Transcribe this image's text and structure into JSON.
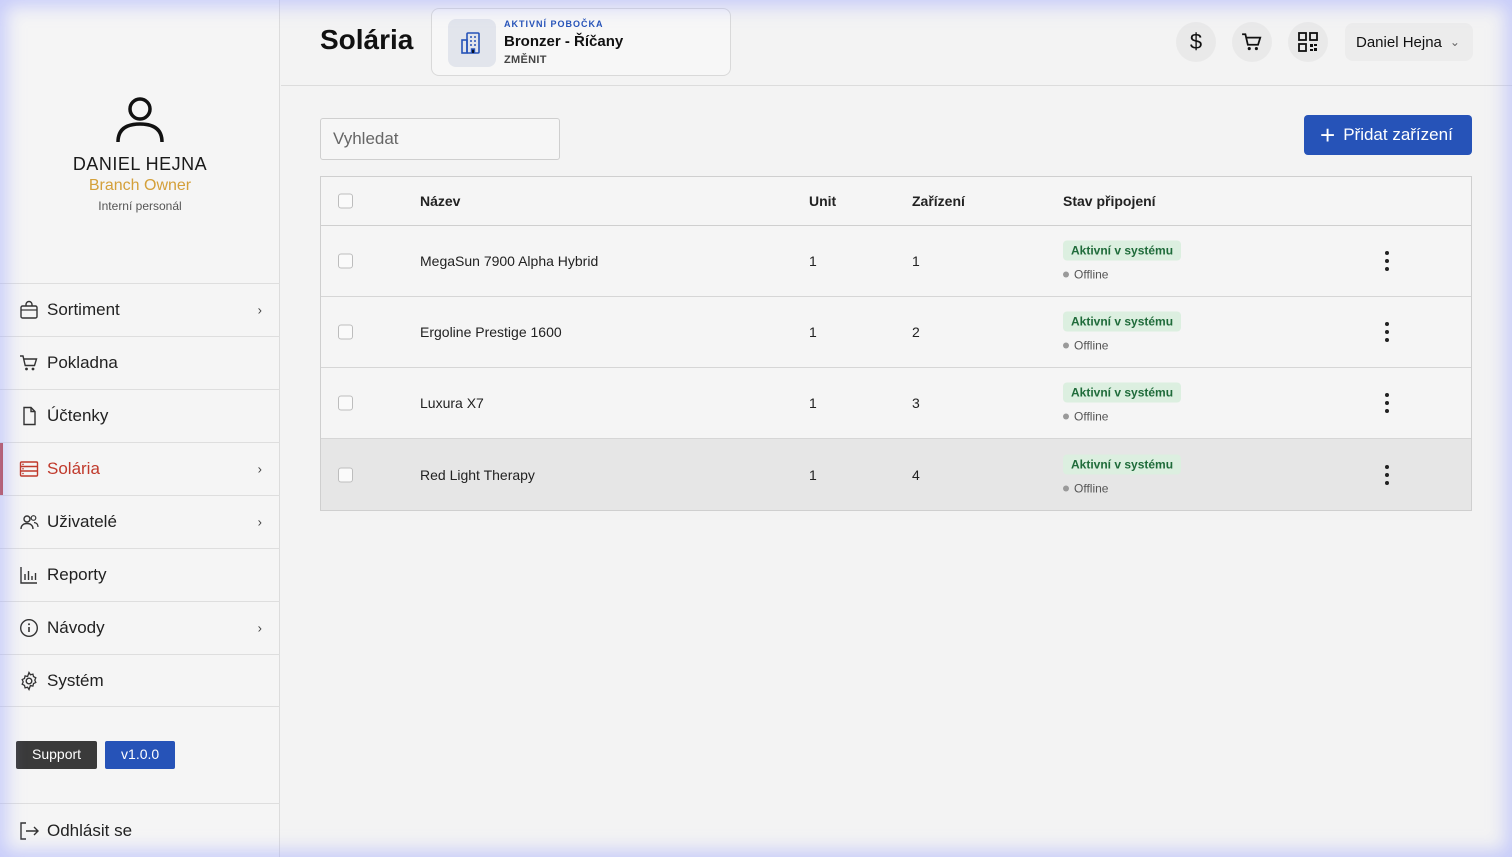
{
  "header": {
    "title": "Solária",
    "branch": {
      "kicker": "AKTIVNÍ POBOČKA",
      "name": "Bronzer - Říčany",
      "change_label": "ZMĚNIT"
    },
    "user_menu": {
      "name": "Daniel Hejna"
    }
  },
  "profile": {
    "name": "DANIEL HEJNA",
    "role": "Branch Owner",
    "type": "Interní personál"
  },
  "sidebar": {
    "items": [
      {
        "label": "Sortiment",
        "icon": "bag-icon",
        "has_children": true
      },
      {
        "label": "Pokladna",
        "icon": "cart-icon",
        "has_children": false
      },
      {
        "label": "Účtenky",
        "icon": "document-icon",
        "has_children": false
      },
      {
        "label": "Solária",
        "icon": "solarium-icon",
        "has_children": true,
        "active": true
      },
      {
        "label": "Uživatelé",
        "icon": "users-icon",
        "has_children": true
      },
      {
        "label": "Reporty",
        "icon": "chart-icon",
        "has_children": false
      },
      {
        "label": "Návody",
        "icon": "info-icon",
        "has_children": true
      },
      {
        "label": "Systém",
        "icon": "gear-icon",
        "has_children": false
      }
    ],
    "support_label": "Support",
    "version_label": "v1.0.0",
    "logout_label": "Odhlásit se"
  },
  "toolbar": {
    "search_placeholder": "Vyhledat",
    "add_label": "Přidat zařízení"
  },
  "table": {
    "columns": {
      "name": "Název",
      "unit": "Unit",
      "device": "Zařízení",
      "status": "Stav připojení"
    },
    "rows": [
      {
        "name": "MegaSun 7900 Alpha Hybrid",
        "unit": "1",
        "device": "1",
        "status": "Aktivní v systému",
        "connection": "Offline"
      },
      {
        "name": "Ergoline Prestige 1600",
        "unit": "1",
        "device": "2",
        "status": "Aktivní v systému",
        "connection": "Offline"
      },
      {
        "name": "Luxura X7",
        "unit": "1",
        "device": "3",
        "status": "Aktivní v systému",
        "connection": "Offline"
      },
      {
        "name": "Red Light Therapy",
        "unit": "1",
        "device": "4",
        "status": "Aktivní v systému",
        "connection": "Offline"
      }
    ]
  },
  "colors": {
    "accent": "#2653b8",
    "active_nav": "#c0392b",
    "role": "#d4a03a",
    "status_bg": "#dcefe0",
    "status_text": "#1f6b3a"
  }
}
